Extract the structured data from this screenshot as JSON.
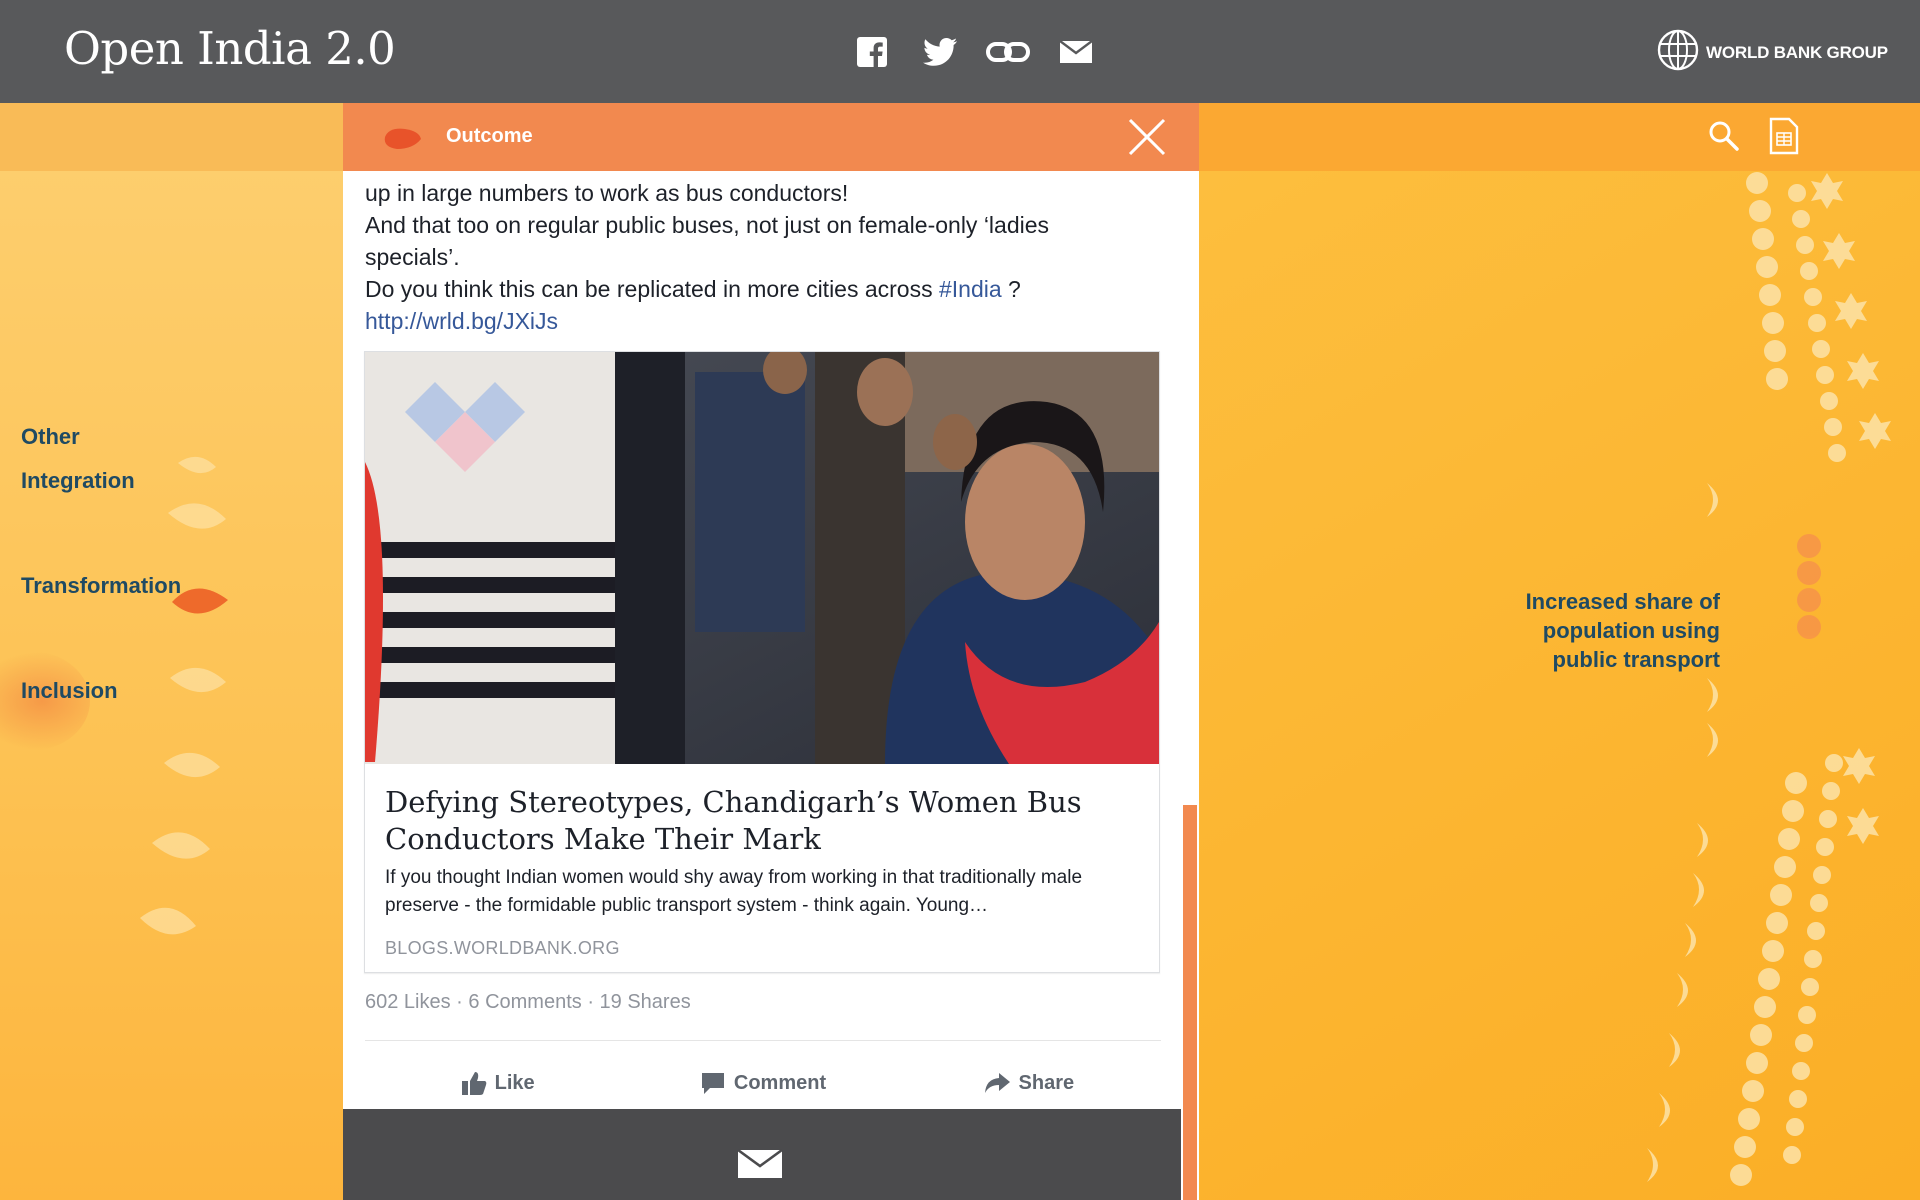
{
  "header": {
    "title": "Open India 2.0",
    "share": [
      {
        "icon": "facebook-icon",
        "label": "Facebook"
      },
      {
        "icon": "twitter-icon",
        "label": "Twitter"
      },
      {
        "icon": "link-icon",
        "label": "Link"
      },
      {
        "icon": "mail-icon",
        "label": "Email"
      }
    ],
    "brand": "WORLD BANK GROUP"
  },
  "sidebar": {
    "items": [
      {
        "label": "Other"
      },
      {
        "label": "Integration"
      },
      {
        "label": "Transformation",
        "active": true
      },
      {
        "label": "Inclusion"
      }
    ]
  },
  "panel": {
    "category": "Outcome",
    "post": {
      "line1": "up in large numbers to work as bus conductors!",
      "line2": "And that too on regular public buses, not just on female-only ‘ladies specials’.",
      "line3_pre": "Do you think this can be replicated in more cities across ",
      "hashtag": "#India",
      "line3_post": " ?",
      "url": "http://wrld.bg/JXiJs"
    },
    "link_card": {
      "title": "Defying Stereotypes, Chandigarh’s Women Bus Conductors Make Their Mark",
      "description": "If you thought Indian women would shy away from working in that traditionally male preserve - the formidable public transport system - think again. Young…",
      "source": "BLOGS.WORLDBANK.ORG"
    },
    "stats": "602 Likes · 6 Comments · 19 Shares",
    "actions": {
      "like": "Like",
      "comment": "Comment",
      "share": "Share"
    }
  },
  "right": {
    "label": "Increased share of population using public transport"
  },
  "colors": {
    "header": "#58595b",
    "accent_orange": "#f2894f",
    "nav_text": "#1f4a63",
    "background_yellow": "#fbb233",
    "link_blue": "#365899"
  }
}
